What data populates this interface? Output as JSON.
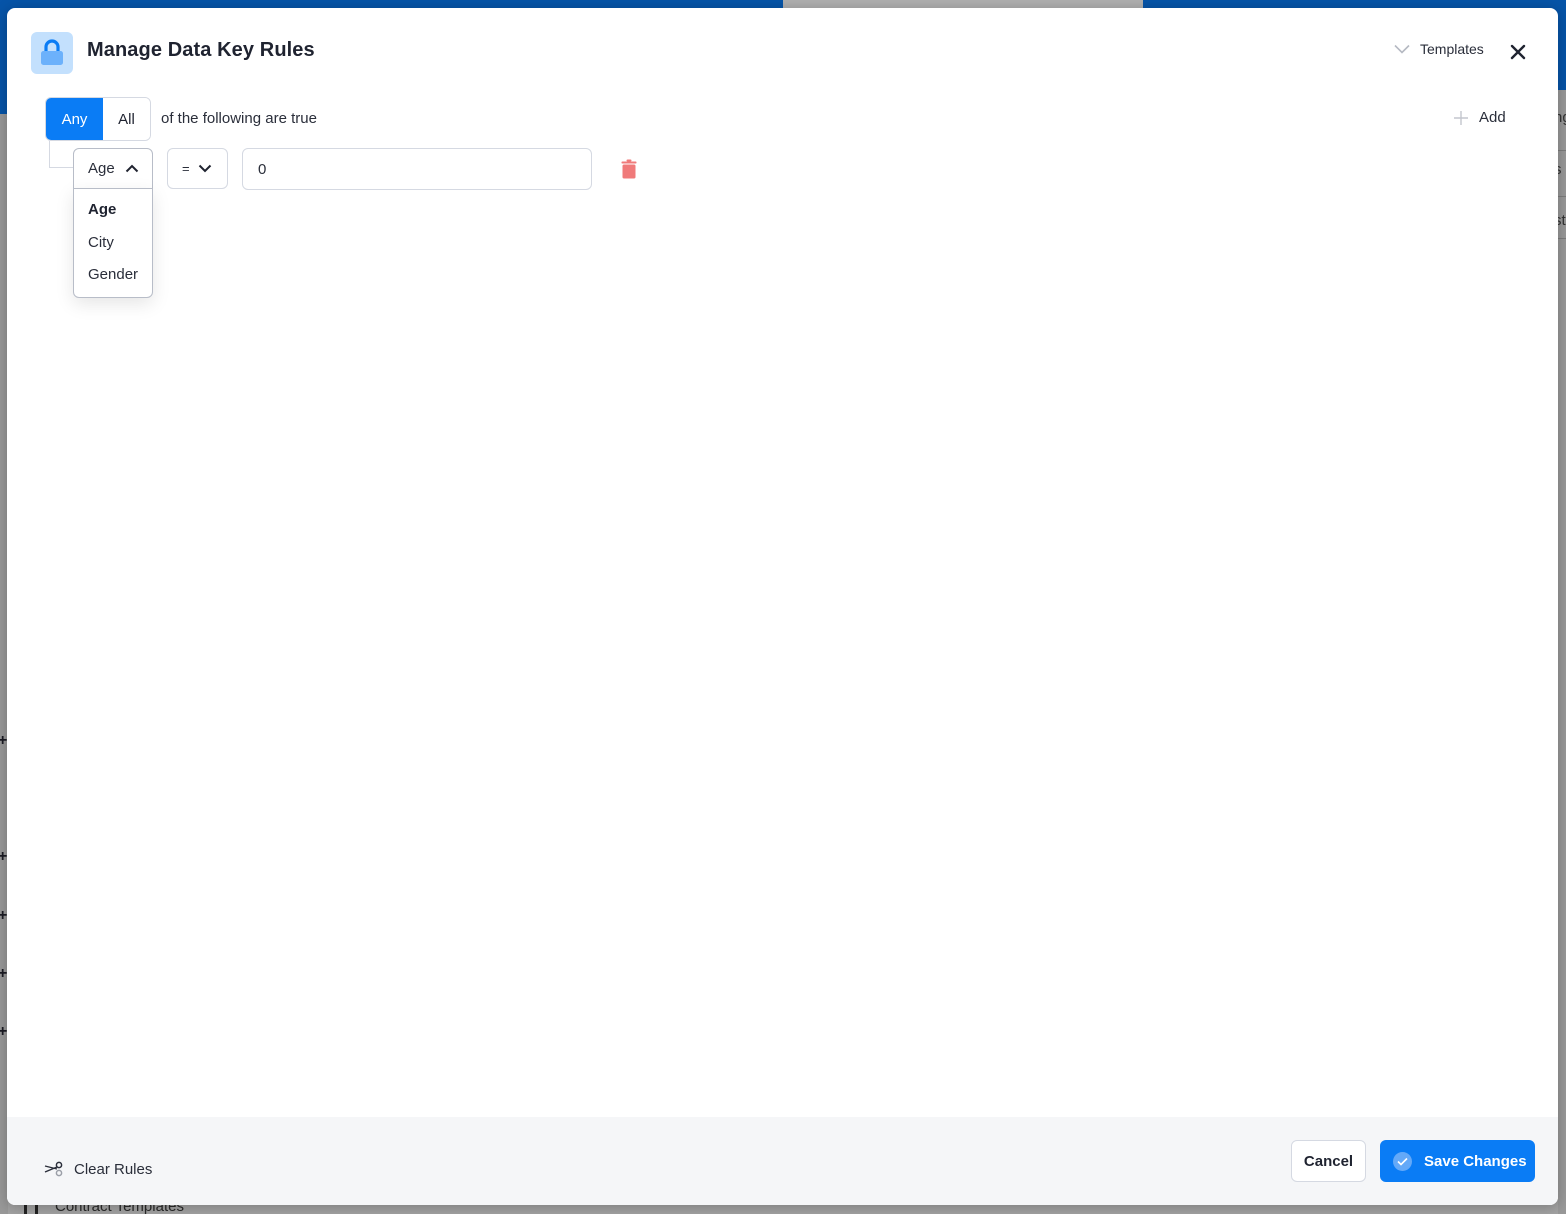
{
  "background": {
    "bottom_item_label": "Contract Templates",
    "right_fragments": [
      "ng",
      "s",
      "st"
    ]
  },
  "modal": {
    "title": "Manage Data Key Rules",
    "header_icon": "lock-icon",
    "templates_label": "Templates",
    "colors": {
      "accent": "#0a7cf5",
      "icon_bg": "#c3e0fd",
      "danger": "#f07a7a",
      "footer_bg": "#f5f6f8"
    }
  },
  "rules": {
    "match_options": [
      {
        "label": "Any",
        "active": true
      },
      {
        "label": "All",
        "active": false
      }
    ],
    "following_text": "of the following are true",
    "add_label": "Add",
    "rows": [
      {
        "field": "Age",
        "operator": "=",
        "value": "0",
        "field_options": [
          {
            "label": "Age",
            "selected": true
          },
          {
            "label": "City",
            "selected": false
          },
          {
            "label": "Gender",
            "selected": false
          }
        ]
      }
    ]
  },
  "footer": {
    "clear_label": "Clear Rules",
    "cancel_label": "Cancel",
    "save_label": "Save Changes"
  }
}
